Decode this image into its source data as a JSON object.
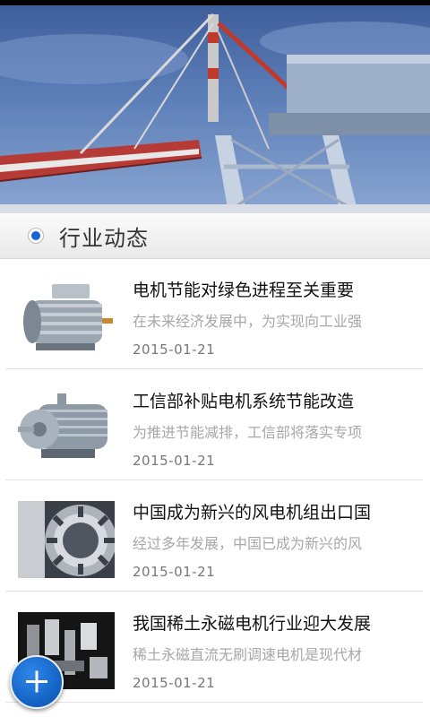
{
  "banner": {
    "icon": "port-crane-photo"
  },
  "section": {
    "title": "行业动态",
    "icon": "radio-selected-icon",
    "accent": "#1a63d6"
  },
  "news": [
    {
      "title": "电机节能对绿色进程至关重要",
      "summary": "在未来经济发展中，为实现向工业强",
      "date": "2015-01-21",
      "thumb": "motor-image"
    },
    {
      "title": "工信部补贴电机系统节能改造",
      "summary": "为推进节能减排，工信部将落实专项",
      "date": "2015-01-21",
      "thumb": "motor-image"
    },
    {
      "title": "中国成为新兴的风电机组出口国",
      "summary": "经过多年发展，中国已成为新兴的风",
      "date": "2015-01-21",
      "thumb": "stator-image"
    },
    {
      "title": "我国稀土永磁电机行业迎大发展",
      "summary": "稀土永磁直流无刷调速电机是现代材",
      "date": "2015-01-21",
      "thumb": "magnet-image"
    }
  ],
  "fab": {
    "icon": "plus-icon",
    "color": "#1565c7"
  }
}
